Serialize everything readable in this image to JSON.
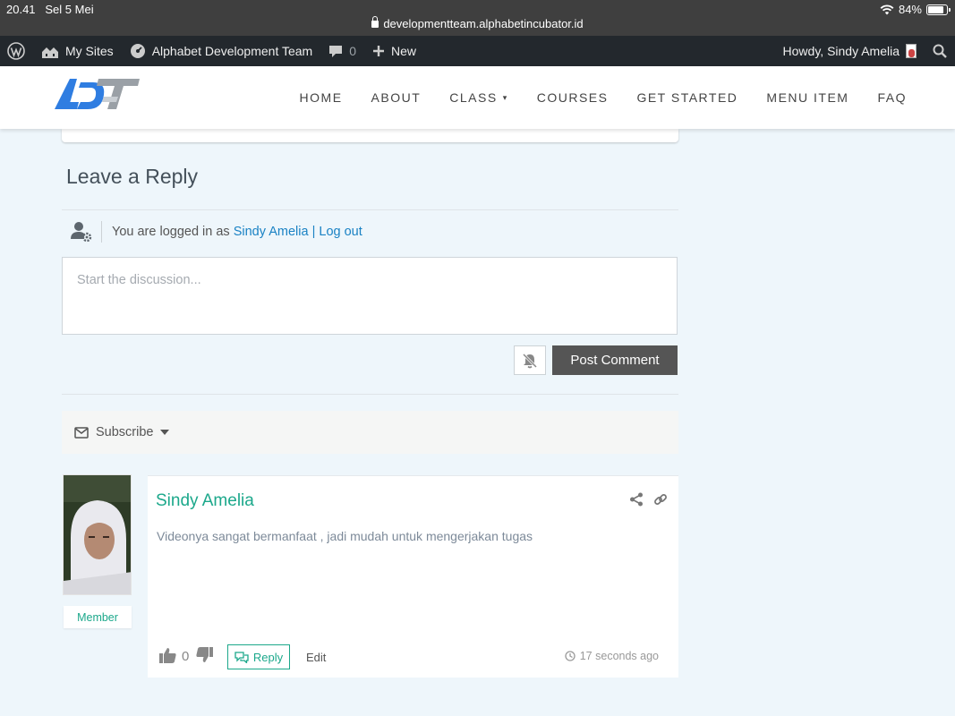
{
  "status_bar": {
    "time": "20.41",
    "date": "Sel 5 Mei",
    "battery": "84%",
    "battery_level": 0.84,
    "url": "developmentteam.alphabetincubator.id"
  },
  "admin_bar": {
    "my_sites": "My Sites",
    "site_name": "Alphabet Development Team",
    "comments_count": "0",
    "new_label": "New",
    "howdy": "Howdy, Sindy Amelia"
  },
  "nav": {
    "items": [
      "HOME",
      "ABOUT",
      "CLASS",
      "COURSES",
      "GET STARTED",
      "MENU ITEM",
      "FAQ"
    ],
    "class_caret": "▾"
  },
  "reply": {
    "title": "Leave a Reply",
    "logged_in_prefix": "You are logged in as",
    "user_name": "Sindy Amelia",
    "separator": "|",
    "logout": "Log out",
    "placeholder": "Start the discussion...",
    "post_button": "Post Comment",
    "subscribe": "Subscribe"
  },
  "comment": {
    "author": "Sindy Amelia",
    "role": "Member",
    "text": "Videonya sangat bermanfaat , jadi mudah untuk mengerjakan tugas",
    "votes": "0",
    "reply_label": "Reply",
    "edit_label": "Edit",
    "time": "17 seconds ago"
  },
  "colors": {
    "accent_green": "#1ca88b",
    "link_blue": "#1a82c4",
    "admin_bar": "#23282d",
    "page_bg": "#eef6fb"
  }
}
